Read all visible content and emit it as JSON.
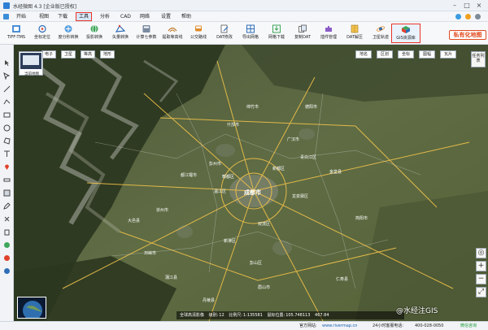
{
  "window": {
    "title": "水经微图 4.3 [企业版已授权]"
  },
  "menu": [
    {
      "label": "开始"
    },
    {
      "label": "视图"
    },
    {
      "label": "下载"
    },
    {
      "label": "工具"
    },
    {
      "label": "分析"
    },
    {
      "label": "CAD"
    },
    {
      "label": "网络"
    },
    {
      "label": "设置"
    },
    {
      "label": "帮助"
    }
  ],
  "toolbar": {
    "tools": [
      {
        "label": "TIFF-TMS",
        "icon": "tiff-tms-icon"
      },
      {
        "label": "坐标定位",
        "icon": "locate-icon"
      },
      {
        "label": "度分秒转换",
        "icon": "dms-convert-icon"
      },
      {
        "label": "投影转换",
        "icon": "projection-icon"
      },
      {
        "label": "矢量转换",
        "icon": "vector-convert-icon"
      },
      {
        "label": "计算七参数",
        "icon": "seven-params-icon"
      },
      {
        "label": "提取等高线",
        "icon": "contour-icon"
      },
      {
        "label": "公交路线",
        "icon": "bus-route-icon"
      },
      {
        "label": "DAT修改",
        "icon": "dat-edit-icon"
      },
      {
        "label": "导出网格",
        "icon": "grid-export-icon"
      },
      {
        "label": "网格下载",
        "icon": "grid-download-icon"
      },
      {
        "label": "复制DAT",
        "icon": "copy-dat-icon"
      },
      {
        "label": "插件管理",
        "icon": "plugin-icon"
      },
      {
        "label": "DAT解压",
        "icon": "dat-unzip-icon"
      },
      {
        "label": "卫星轨迹",
        "icon": "satellite-icon"
      },
      {
        "label": "GIS资源库",
        "icon": "gis-library-icon"
      }
    ],
    "brand": "私有化地图"
  },
  "map": {
    "left_tabs": [
      "电子",
      "卫星",
      "等高",
      "地形"
    ],
    "right_tabs": [
      "地名",
      "区划",
      "坐标",
      "图幅",
      "瓦片"
    ],
    "task_button": "任务列表",
    "thumbnail_label": "当前地图",
    "places": [
      "成都市",
      "德阳市",
      "绵竹市",
      "什邡市",
      "彭州市",
      "都江堰市",
      "崇州市",
      "温江区",
      "双流区",
      "新津区",
      "简阳市",
      "金堂县",
      "广汉市",
      "眉山市",
      "邛崃市",
      "大邑县",
      "郫都区",
      "新都区",
      "龙泉驿区",
      "青白江区",
      "蒲江县",
      "丹棱县",
      "彭山区",
      "仁寿县"
    ],
    "status": {
      "prefix": "全球高清影像",
      "level_label": "级别:",
      "level": "12",
      "scale_label": "比例尺:",
      "scale": "1:135581",
      "coords_label": "鼠标位置:",
      "coords": "105.748113",
      "elevation": "467.84"
    },
    "watermark": "@水经注GIS"
  },
  "footer": {
    "site_label": "官方网站:",
    "site": "www.rivermap.cn",
    "hotline_label": "24小时客服电话:",
    "hotline": "400-028-0050",
    "wechat": "微信咨询"
  },
  "colors": {
    "highlight_border": "#e8332a",
    "brand": "#e04a1e"
  }
}
